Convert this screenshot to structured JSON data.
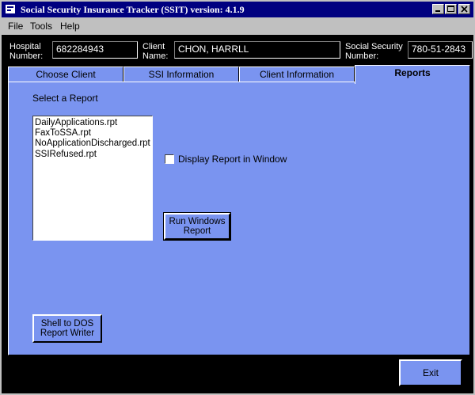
{
  "window": {
    "title": "Social Security Insurance Tracker (SSIT) version: 4.1.9"
  },
  "menu": [
    "File",
    "Tools",
    "Help"
  ],
  "info": {
    "hospital_label_1": "Hospital",
    "hospital_label_2": "Number:",
    "hospital_value": "682284943",
    "client_label_1": "Client",
    "client_label_2": "Name:",
    "client_value": "CHON, HARRLL",
    "ssn_label_1": "Social Security",
    "ssn_label_2": "Number:",
    "ssn_value": "780-51-2843"
  },
  "tabs": [
    "Choose Client",
    "SSI Information",
    "Client Information",
    "Reports"
  ],
  "reports": {
    "select_label": "Select a Report",
    "items": [
      "DailyApplications.rpt",
      "FaxToSSA.rpt",
      "NoApplicationDischarged.rpt",
      "SSIRefused.rpt"
    ],
    "display_checkbox_label": "Display Report in Window",
    "display_checked": false,
    "run_button_line1": "Run Windows",
    "run_button_line2": "Report",
    "shell_button_line1": "Shell to DOS",
    "shell_button_line2": "Report Writer"
  },
  "footer": {
    "exit_label": "Exit"
  }
}
